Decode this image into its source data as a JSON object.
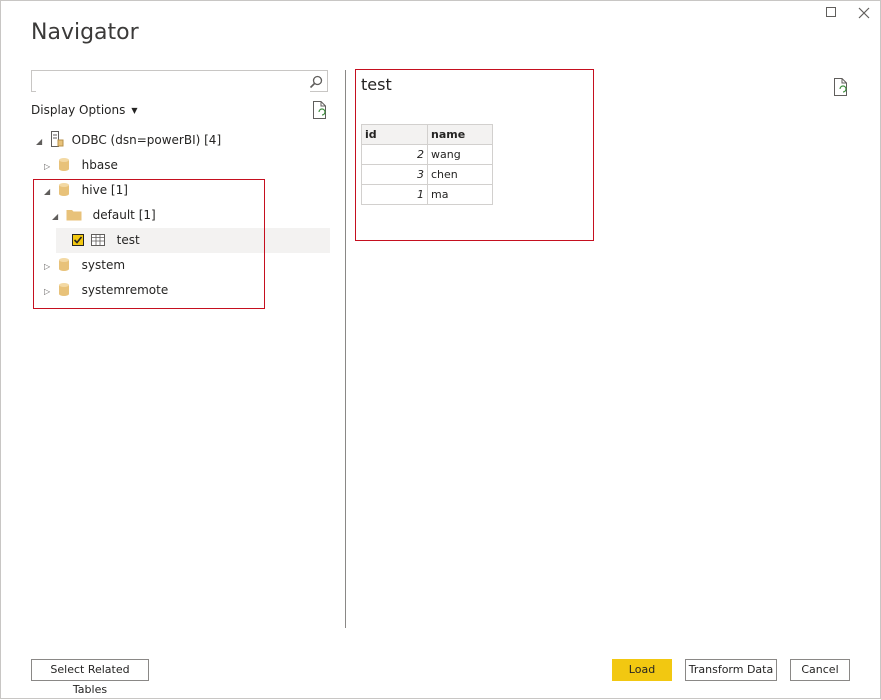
{
  "window": {
    "title": "Navigator"
  },
  "search": {
    "placeholder": "",
    "value": ""
  },
  "display_options": {
    "label": "Display Options"
  },
  "tree": {
    "root": {
      "label": "ODBC (dsn=powerBI) [4]"
    },
    "items": [
      {
        "label": "hbase"
      },
      {
        "label": "hive [1]"
      },
      {
        "label": "default [1]"
      },
      {
        "label": "test",
        "checked": true
      },
      {
        "label": "system"
      },
      {
        "label": "systemremote"
      }
    ]
  },
  "preview": {
    "title": "test",
    "columns": [
      "id",
      "name"
    ],
    "rows": [
      {
        "id": "2",
        "name": "wang"
      },
      {
        "id": "3",
        "name": "chen"
      },
      {
        "id": "1",
        "name": "ma"
      }
    ]
  },
  "footer": {
    "select_related": "Select Related Tables",
    "load": "Load",
    "transform": "Transform Data",
    "cancel": "Cancel"
  },
  "colors": {
    "accent": "#f2c811",
    "highlight_border": "#c50f1f",
    "folder": "#e8c27a"
  }
}
